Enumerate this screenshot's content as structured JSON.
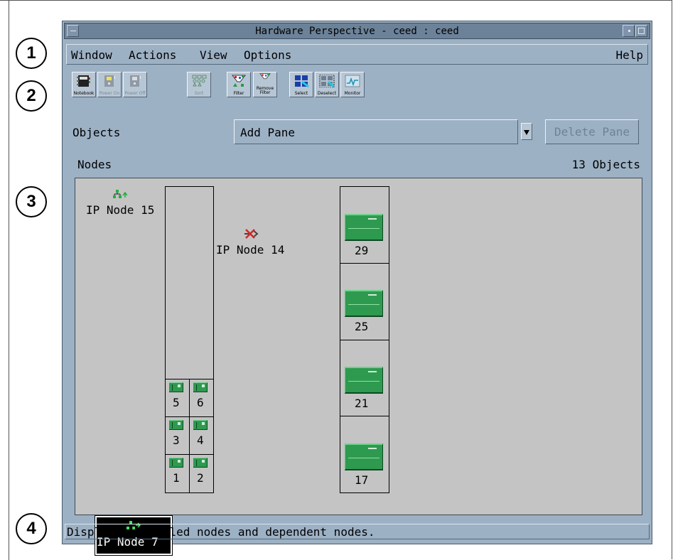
{
  "window": {
    "title": "Hardware Perspective - ceed : ceed"
  },
  "callouts": [
    "1",
    "2",
    "3",
    "4"
  ],
  "menu": {
    "items": [
      "Window",
      "Actions",
      "View",
      "Options"
    ],
    "help": "Help"
  },
  "toolbar": {
    "buttons": [
      {
        "label": "Notebook",
        "icon": "notebook-icon",
        "enabled": true
      },
      {
        "label": "Power On",
        "icon": "power-on-icon",
        "enabled": false
      },
      {
        "label": "Power Off",
        "icon": "power-off-icon",
        "enabled": false
      },
      {
        "label": "Sort",
        "icon": "sort-icon",
        "enabled": false
      },
      {
        "label": "Filter",
        "icon": "filter-icon",
        "enabled": true
      },
      {
        "label": "Remove Filter",
        "icon": "remove-filter-icon",
        "enabled": true
      },
      {
        "label": "Select",
        "icon": "select-icon",
        "enabled": true
      },
      {
        "label": "Deselect",
        "icon": "deselect-icon",
        "enabled": true
      },
      {
        "label": "Monitor",
        "icon": "monitor-icon",
        "enabled": true
      }
    ]
  },
  "objects_row": {
    "label": "Objects",
    "pane_select": "Add Pane",
    "delete_button": "Delete Pane"
  },
  "pane": {
    "title": "Nodes",
    "count": "13 Objects",
    "ip_nodes": [
      {
        "label": "IP Node 15",
        "icon": "network-node-icon",
        "selected": false
      },
      {
        "label": "IP Node 14",
        "icon": "disconnected-node-icon",
        "selected": false
      },
      {
        "label": "IP Node 7",
        "icon": "network-node-icon",
        "selected": true
      }
    ],
    "small_nodes": [
      "5",
      "6",
      "3",
      "4",
      "1",
      "2"
    ],
    "large_nodes": [
      "29",
      "25",
      "21",
      "17"
    ]
  },
  "status": {
    "text": "Displays installed nodes and dependent nodes."
  },
  "colors": {
    "window_bg": "#9db1c5",
    "pane_bg": "#c4c4c4",
    "node_green": "#2e9a4f",
    "selection_bg": "#000000"
  }
}
